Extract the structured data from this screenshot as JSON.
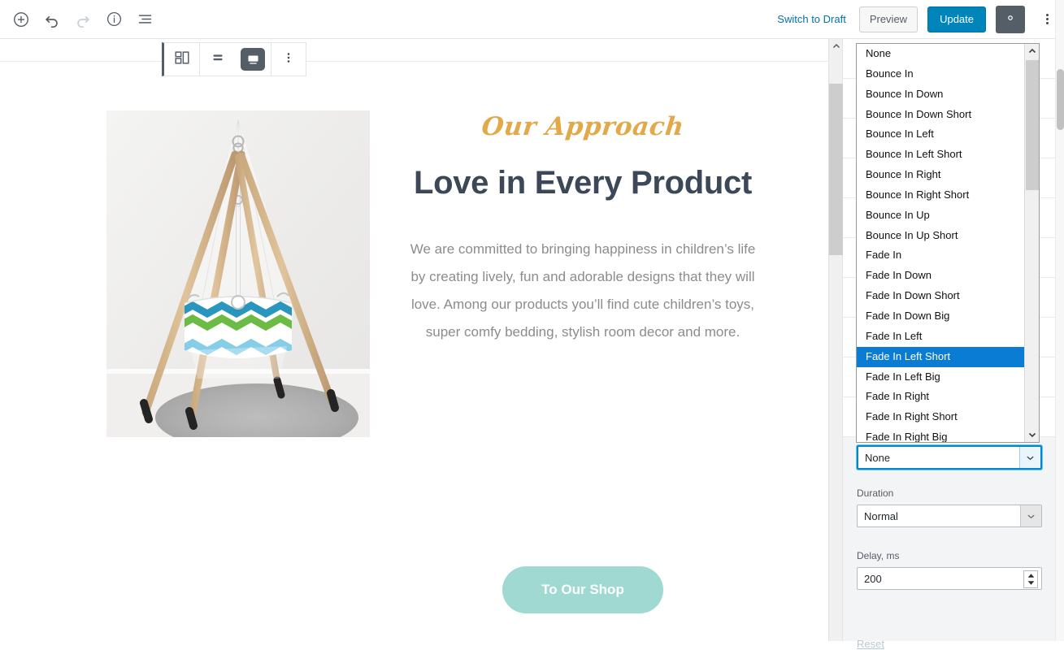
{
  "header": {
    "icons": {
      "add_block": "plus-circle-icon",
      "undo": "undo-icon",
      "redo": "redo-icon",
      "info": "info-icon",
      "list_view": "list-view-icon",
      "settings": "gear-icon",
      "more": "kebab-menu-icon"
    },
    "switch_to_draft": "Switch to Draft",
    "preview": "Preview",
    "update": "Update"
  },
  "block_toolbar": {
    "block_type_icon": "media-text-block-icon",
    "align_icon": "vertical-align-icon",
    "media_position_icon": "media-on-top-icon",
    "more_options_icon": "kebab-menu-icon"
  },
  "content": {
    "image_alt": "hanging baby cradle on wooden tripod stand with chevron fabric",
    "eyebrow": "Our Approach",
    "heading": "Love in Every Product",
    "paragraph": "We are committed to bringing happiness in children’s life by creating lively, fun and adorable designs that they will love. Among our products you’ll find cute children’s toys, super comfy bedding, stylish room decor and more.",
    "cta_label": "To Our Shop"
  },
  "sidebar": {
    "animation_select": {
      "value": "None",
      "chevron_icon": "chevron-down-icon"
    },
    "duration": {
      "label": "Duration",
      "value": "Normal",
      "chevron_icon": "chevron-down-icon"
    },
    "delay": {
      "label": "Delay, ms",
      "value": "200",
      "spinner_icon": "spinner-up-down-icon"
    },
    "reset_label": "Reset"
  },
  "dropdown": {
    "selected": "Fade In Left Short",
    "scroll_up_icon": "chevron-up-icon",
    "scroll_down_icon": "chevron-down-icon",
    "options": [
      "None",
      "Bounce In",
      "Bounce In Down",
      "Bounce In Down Short",
      "Bounce In Left",
      "Bounce In Left Short",
      "Bounce In Right",
      "Bounce In Right Short",
      "Bounce In Up",
      "Bounce In Up Short",
      "Fade In",
      "Fade In Down",
      "Fade In Down Short",
      "Fade In Down Big",
      "Fade In Left",
      "Fade In Left Short",
      "Fade In Left Big",
      "Fade In Right",
      "Fade In Right Short",
      "Fade In Right Big"
    ]
  },
  "colors": {
    "accent_blue": "#0085ba",
    "link_blue": "#0073aa",
    "highlight_blue": "#0a7cd4",
    "eyebrow_gold": "#e2a94b",
    "heading_slate": "#3c4858",
    "body_grey": "#8c8c8c",
    "cta_teal": "#9fd9d1",
    "sidebar_bg": "#f3f4f5"
  }
}
